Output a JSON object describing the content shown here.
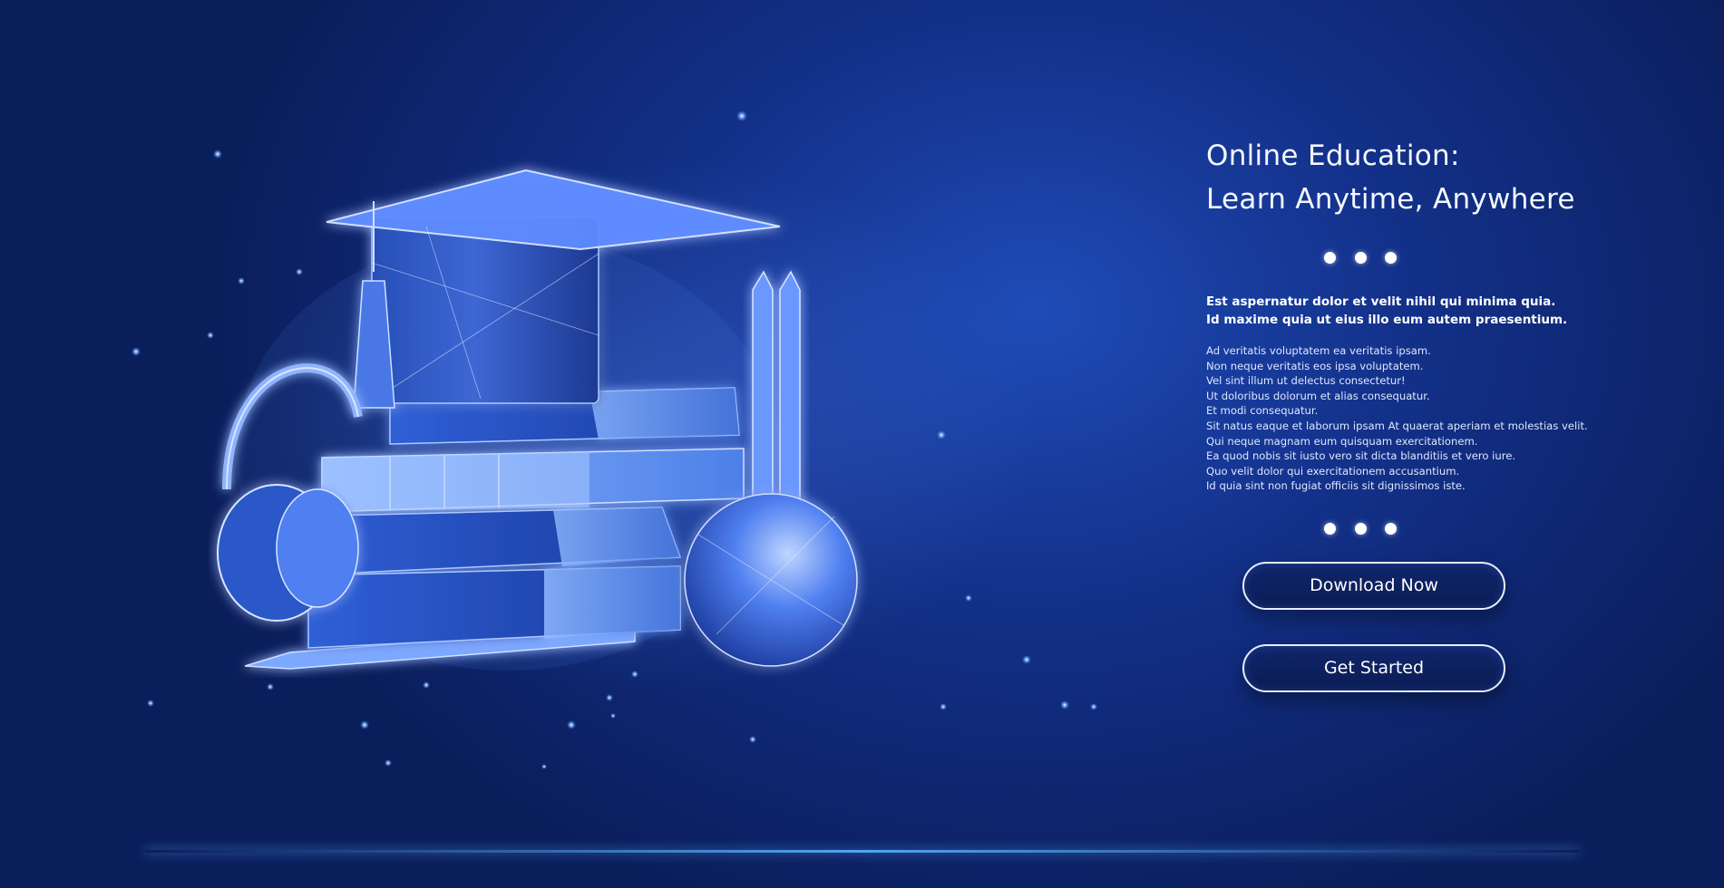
{
  "hero": {
    "title_line1": "Online Education:",
    "title_line2": "Learn Anytime, Anywhere",
    "lead_lines": [
      "Est aspernatur dolor et velit nihil qui minima quia.",
      "Id maxime quia ut eius illo eum autem praesentium."
    ],
    "body_lines": [
      "Ad veritatis voluptatem ea veritatis ipsam.",
      "Non neque veritatis eos ipsa voluptatem.",
      "Vel sint illum ut delectus consectetur!",
      "Ut doloribus dolorum et alias consequatur.",
      "Et modi consequatur.",
      "Sit natus eaque et laborum ipsam At quaerat aperiam et molestias velit.",
      "Qui neque magnam eum quisquam exercitationem.",
      "Ea quod nobis sit iusto vero sit dicta blanditiis et vero iure.",
      "Quo velit dolor qui exercitationem accusantium.",
      "Id quia sint non fugiat officiis sit dignissimos iste."
    ]
  },
  "actions": {
    "download_label": "Download Now",
    "start_label": "Get Started"
  },
  "illustration": {
    "items": [
      "graduation-cap-icon",
      "book-stack-icon",
      "headphones-icon",
      "pencil-icon",
      "globe-sphere-icon"
    ]
  },
  "colors": {
    "background_dark": "#0b1e5c",
    "background_mid": "#1f4cb8",
    "glow": "#6fa8ff",
    "text": "#ffffff",
    "button_fill": "#0b1c55",
    "button_border": "#e8eeff"
  }
}
